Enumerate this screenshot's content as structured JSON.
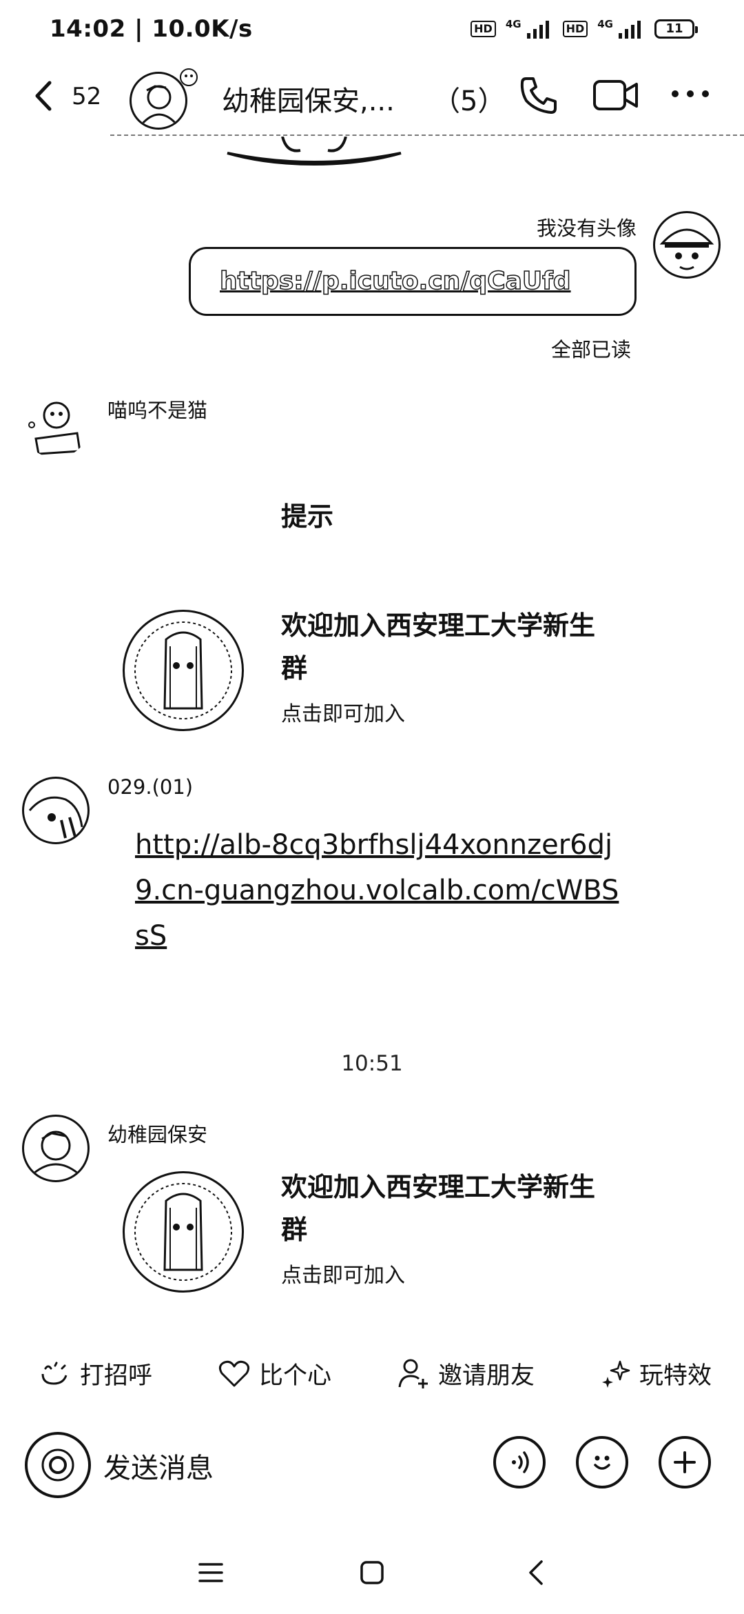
{
  "status_bar": {
    "time": "14:02 | 10.0K/s",
    "hd1": "HD",
    "net1": "4G",
    "hd2": "HD",
    "net2": "4G",
    "battery": "11"
  },
  "header": {
    "back_count": "52",
    "title": "幼稚园保安,...",
    "member_count": "（5）"
  },
  "messages": {
    "self": {
      "nickname": "我没有头像",
      "link_text": "https://p.icuto.cn/qCaUfd",
      "read_status": "全部已读"
    },
    "msg1": {
      "nickname": "喵呜不是猫",
      "hint_title": "提示",
      "card_title": "欢迎加入西安理工大学新生群",
      "card_subtitle": "点击即可加入"
    },
    "msg2": {
      "nickname": "029.(01)",
      "url": "http://alb-8cq3brfhslj44xonnzer6dj9.cn-guangzhou.volcalb.com/cWBSsS"
    },
    "timestamp": "10:51",
    "msg3": {
      "nickname": "幼稚园保安",
      "card_title": "欢迎加入西安理工大学新生群",
      "card_subtitle": "点击即可加入"
    }
  },
  "actions": {
    "greet": "打招呼",
    "heart": "比个心",
    "invite": "邀请朋友",
    "effects": "玩特效"
  },
  "input": {
    "placeholder": "发送消息"
  },
  "icons": {
    "back": "chevron-left-icon",
    "call": "phone-icon",
    "video": "video-camera-icon",
    "more": "more-dots-icon",
    "camera": "camera-icon",
    "voice": "voice-icon",
    "emoji": "emoji-icon",
    "plus": "plus-icon"
  }
}
